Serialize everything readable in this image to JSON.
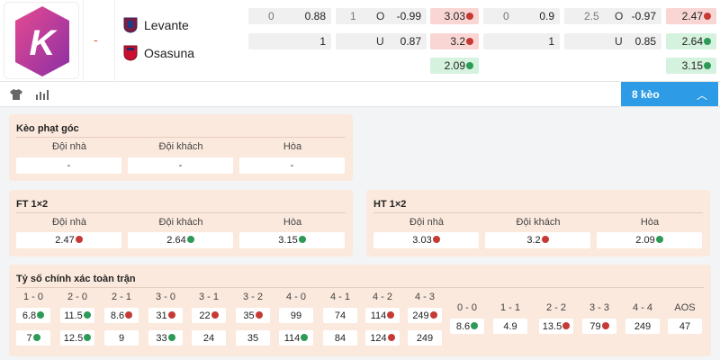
{
  "match": {
    "logo_letter": "K",
    "score_dash": "-",
    "home_team": "Levante",
    "away_team": "Osasuna",
    "ft_handicap": {
      "home": {
        "line": "0",
        "odds": "0.88"
      },
      "away": {
        "line": "",
        "odds": "1"
      }
    },
    "ft_over_under": {
      "over": {
        "line": "1",
        "label": "O",
        "odds": "-0.99"
      },
      "under": {
        "label": "U",
        "odds": "0.87"
      }
    },
    "ft_1x2": {
      "home": "3.03",
      "away": "3.2",
      "draw": "2.09"
    },
    "ht_handicap": {
      "home": {
        "line": "0",
        "odds": "0.9"
      },
      "away": {
        "odds": "1"
      }
    },
    "ht_over_under": {
      "over": {
        "line": "2.5",
        "label": "O",
        "odds": "-0.97"
      },
      "under": {
        "label": "U",
        "odds": "0.85"
      }
    },
    "ht_1x2": {
      "home": "2.47",
      "away": "2.64",
      "draw": "3.15"
    }
  },
  "toolbar": {
    "shirt_icon": "shirt-icon",
    "stats_icon": "stats-icon",
    "markets_button": "8 kèo",
    "chevron": "^"
  },
  "corner": {
    "title": "Kèo phạt góc",
    "headers": [
      "Đội nhà",
      "Đội khách",
      "Hòa"
    ],
    "values": [
      "-",
      "-",
      "-"
    ]
  },
  "ft": {
    "title": "FT 1×2",
    "headers": [
      "Đội nhà",
      "Đội khách",
      "Hòa"
    ],
    "values": [
      "2.47",
      "2.64",
      "3.15"
    ]
  },
  "ht": {
    "title": "HT 1×2",
    "headers": [
      "Đội nhà",
      "Đội khách",
      "Hòa"
    ],
    "values": [
      "3.03",
      "3.2",
      "2.09"
    ]
  },
  "correct_score": {
    "title": "Tỷ số chính xác toàn trận",
    "home_scores": [
      "1 - 0",
      "2 - 0",
      "2 - 1",
      "3 - 0",
      "3 - 1",
      "3 - 2",
      "4 - 0",
      "4 - 1",
      "4 - 2",
      "4 - 3"
    ],
    "home_odds": [
      "6.8",
      "11.5",
      "8.6",
      "31",
      "22",
      "35",
      "99",
      "74",
      "114",
      "249"
    ],
    "away_odds": [
      "7",
      "12.5",
      "9",
      "33",
      "24",
      "35",
      "114",
      "84",
      "124",
      "249"
    ],
    "draw_scores": [
      "0 - 0",
      "1 - 1",
      "2 - 2",
      "3 - 3",
      "4 - 4",
      "AOS"
    ],
    "draw_odds": [
      "8.6",
      "4.9",
      "13.5",
      "79",
      "249",
      "47"
    ]
  },
  "colors": {
    "accent": "#2d9be5",
    "down": "#c63a35",
    "up": "#2e9a57",
    "pink": "#f9d6d4",
    "green": "#d4f2dd",
    "panel": "#fbe9dd"
  }
}
